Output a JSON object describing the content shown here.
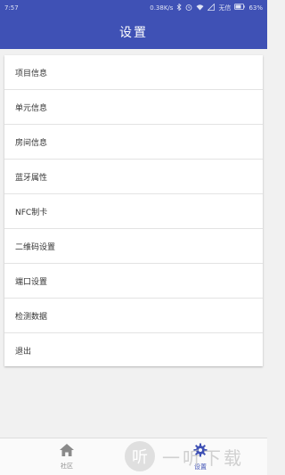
{
  "status_bar": {
    "time": "7:57",
    "network_speed": "0.38K/s",
    "carrier": "无信",
    "battery": "63%",
    "icons": [
      "bluetooth-icon",
      "alarm-icon",
      "wifi-icon",
      "signal-icon",
      "battery-icon"
    ]
  },
  "app_bar": {
    "title": "设置"
  },
  "menu": {
    "items": [
      {
        "label": "项目信息"
      },
      {
        "label": "单元信息"
      },
      {
        "label": "房间信息"
      },
      {
        "label": "蓝牙属性"
      },
      {
        "label": "NFC制卡"
      },
      {
        "label": "二维码设置"
      },
      {
        "label": "端口设置"
      },
      {
        "label": "检测数据"
      },
      {
        "label": "退出"
      }
    ]
  },
  "bottom_nav": {
    "tabs": [
      {
        "label": "社区",
        "icon": "home-icon",
        "active": false
      },
      {
        "label": "设置",
        "icon": "gear-icon",
        "active": true
      }
    ]
  },
  "watermark": {
    "glyph": "听",
    "text": "一听下载"
  },
  "colors": {
    "primary": "#3f51b5",
    "background": "#f1f1f1",
    "card": "#ffffff",
    "text": "#333333"
  }
}
